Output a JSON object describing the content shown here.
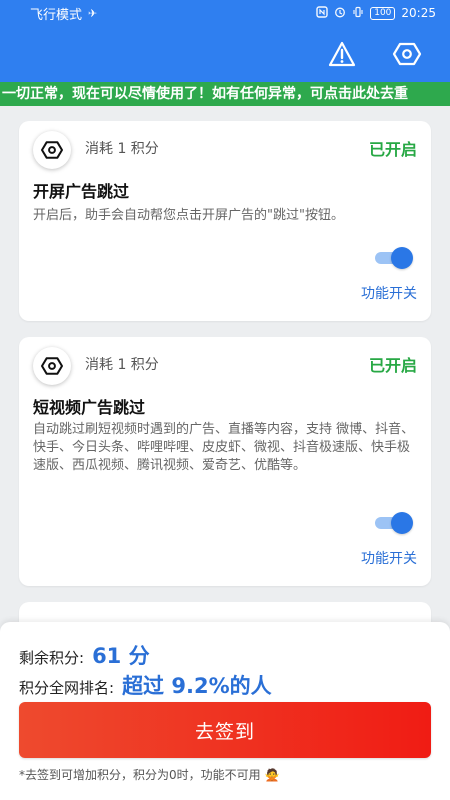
{
  "status_bar": {
    "mode": "飞行模式",
    "airplane_icon": "✈",
    "battery": "100",
    "time": "20:25"
  },
  "toolbar": {
    "warning_icon": "warning-triangle-icon",
    "eye_icon": "hexagon-eye-icon"
  },
  "ticker": {
    "text": "一切正常，现在可以尽情使用了！如有任何异常，可点击此处去重"
  },
  "cards": [
    {
      "cost": "消耗 1 积分",
      "state": "已开启",
      "title": "开屏广告跳过",
      "description": "开启后，助手会自动帮您点击开屏广告的\"跳过\"按钮。",
      "toggle_on": true,
      "func_label": "功能开关"
    },
    {
      "cost": "消耗 1 积分",
      "state": "已开启",
      "title": "短视频广告跳过",
      "description": "自动跳过刷短视频时遇到的广告、直播等内容，支持 微博、抖音、快手、今日头条、哔哩哔哩、皮皮虾、微视、抖音极速版、快手极速版、西瓜视频、腾讯视频、爱奇艺、优酷等。",
      "toggle_on": true,
      "func_label": "功能开关"
    }
  ],
  "bottom": {
    "points_label": "剩余积分:",
    "points_value": "61 分",
    "rank_label": "积分全网排名:",
    "rank_value": "超过 9.2%的人",
    "signin_label": "去签到",
    "note": "*去签到可增加积分，积分为0时，功能不可用 🙅"
  },
  "colors": {
    "header": "#2f7ff0",
    "ticker": "#2ea94d",
    "state_on": "#27a844",
    "accent": "#2a6fd6",
    "signin": "#f01c14"
  }
}
